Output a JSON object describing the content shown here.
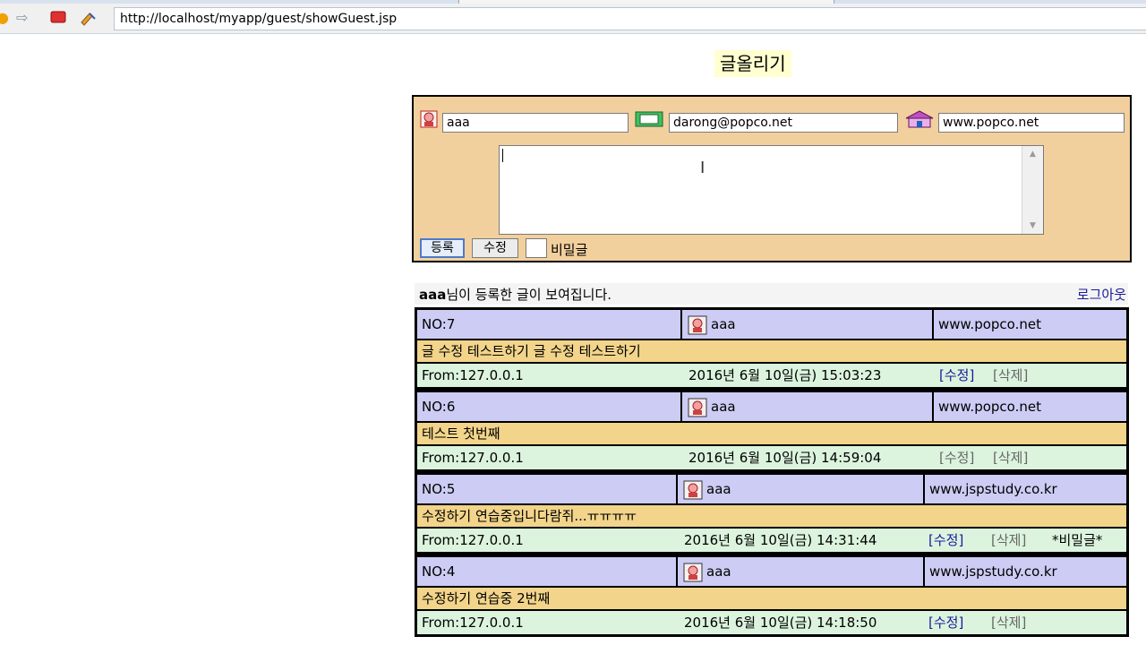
{
  "browser": {
    "back_icon": "back-arrow-icon",
    "forward_icon": "forward-arrow-icon",
    "stop_icon": "stop-icon",
    "refresh_icon": "refresh-icon",
    "url": "http://localhost/myapp/guest/showGuest.jsp"
  },
  "page": {
    "title": "글올리기"
  },
  "form": {
    "name_value": "aaa",
    "email_value": "darong@popco.net",
    "homepage_value": "www.popco.net",
    "content_value": "",
    "submit_label": "등록",
    "edit_label": "수정",
    "secret_label": "비밀글",
    "secret_checked": false
  },
  "list": {
    "user_name": "aaa",
    "notice_suffix": "님이 등록한 글이 보여집니다.",
    "logout_label": "로그아웃"
  },
  "entries": [
    {
      "no": "NO:7",
      "name": "aaa",
      "homepage": "www.popco.net",
      "content": "글 수정 테스트하기 글 수정 테스트하기",
      "from": "From:127.0.0.1",
      "date": "2016년 6월 10일(금) 15:03:23",
      "edit": "[수정]",
      "delete": "[삭제]",
      "secret": ""
    },
    {
      "no": "NO:6",
      "name": "aaa",
      "homepage": "www.popco.net",
      "content": "테스트 첫번째",
      "from": "From:127.0.0.1",
      "date": "2016년 6월 10일(금) 14:59:04",
      "edit": "[수정]",
      "delete": "[삭제]",
      "secret": ""
    },
    {
      "no": "NO:5",
      "name": "aaa",
      "homepage": "www.jspstudy.co.kr",
      "content": "수정하기 연습중입니다람쥐...ㅠㅠㅠㅠ",
      "from": "From:127.0.0.1",
      "date": "2016년 6월 10일(금) 14:31:44",
      "edit": "[수정]",
      "delete": "[삭제]",
      "secret": "*비밀글*"
    },
    {
      "no": "NO:4",
      "name": "aaa",
      "homepage": "www.jspstudy.co.kr",
      "content": "수정하기 연습중 2번째",
      "from": "From:127.0.0.1",
      "date": "2016년 6월 10일(금) 14:18:50",
      "edit": "[수정]",
      "delete": "[삭제]",
      "secret": ""
    }
  ]
}
